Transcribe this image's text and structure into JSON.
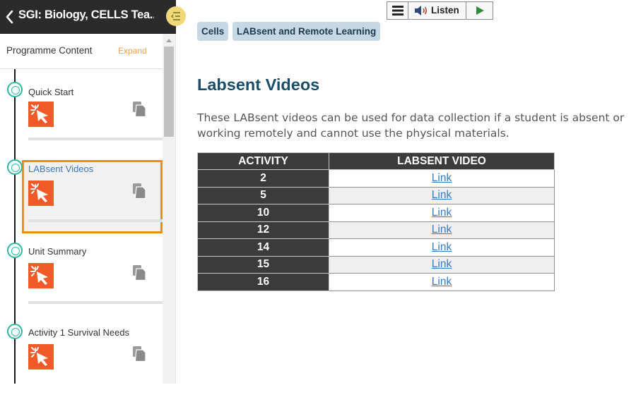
{
  "sidebar": {
    "course_title": "SGI: Biology, CELLS Tea...",
    "programme_label": "Programme Content",
    "expand_label": "Expand",
    "items": [
      {
        "title": "Quick Start"
      },
      {
        "title": "LABsent Videos",
        "active": true
      },
      {
        "title": "Unit Summary"
      },
      {
        "title": "Activity 1 Survival Needs"
      }
    ]
  },
  "toolbar": {
    "listen_label": "Listen"
  },
  "breadcrumbs": [
    "Cells",
    "LABsent and Remote Learning"
  ],
  "main": {
    "title": "Labsent Videos",
    "intro": "These LABsent videos can be used for data collection if a student is absent or working remotely and cannot use the physical materials."
  },
  "table": {
    "headers": [
      "ACTIVITY",
      "LABSENT VIDEO"
    ],
    "rows": [
      {
        "activity": "2",
        "link": "Link"
      },
      {
        "activity": "5",
        "link": "Link"
      },
      {
        "activity": "10",
        "link": "Link"
      },
      {
        "activity": "12",
        "link": "Link"
      },
      {
        "activity": "14",
        "link": "Link"
      },
      {
        "activity": "15",
        "link": "Link"
      },
      {
        "activity": "16",
        "link": "Link"
      }
    ]
  },
  "colors": {
    "accent_orange": "#ef8d12",
    "activity_icon": "#f05a28",
    "timeline_node": "#2fb7a0",
    "title_blue": "#1a4d68",
    "link_blue": "#3a79c1",
    "breadcrumb_bg": "#c6d8e3",
    "header_dark": "#2b2b2b"
  },
  "icons": [
    "back-chevron-icon",
    "collapse-menu-icon",
    "activity-cursor-icon",
    "copy-icon",
    "hamburger-menu-icon",
    "speaker-icon",
    "play-icon"
  ]
}
